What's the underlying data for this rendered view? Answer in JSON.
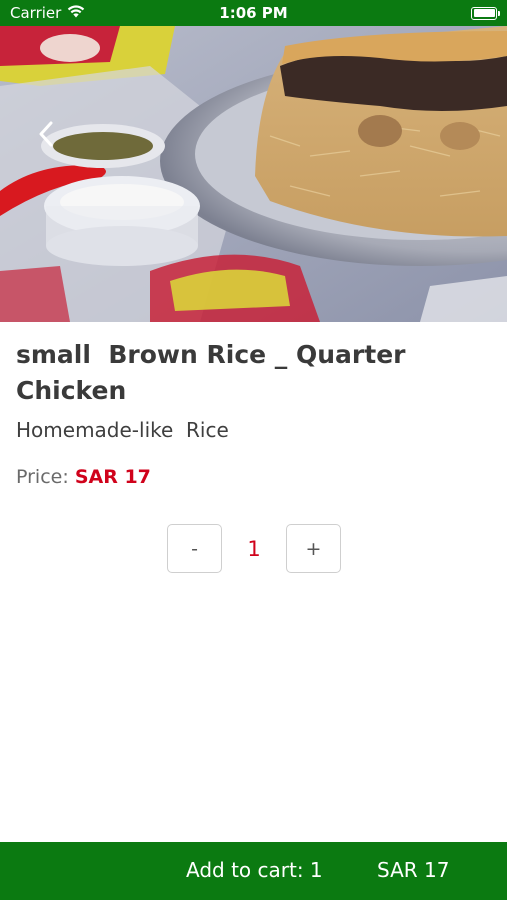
{
  "status_bar": {
    "carrier": "Carrier",
    "time": "1:06 PM"
  },
  "product": {
    "title": "small  Brown Rice _ Quarter Chicken",
    "subtitle": "Homemade-like  Rice",
    "price_label": "Price:",
    "price_value": "SAR 17"
  },
  "quantity": {
    "minus_label": "-",
    "value": "1",
    "plus_label": "+"
  },
  "cart_bar": {
    "add_label": "Add to cart: 1",
    "total": "SAR 17"
  },
  "colors": {
    "brand_green": "#0b7a11",
    "price_red": "#d0021b"
  },
  "icons": {
    "back": "chevron-left-icon",
    "wifi": "wifi-icon",
    "battery": "battery-icon"
  }
}
